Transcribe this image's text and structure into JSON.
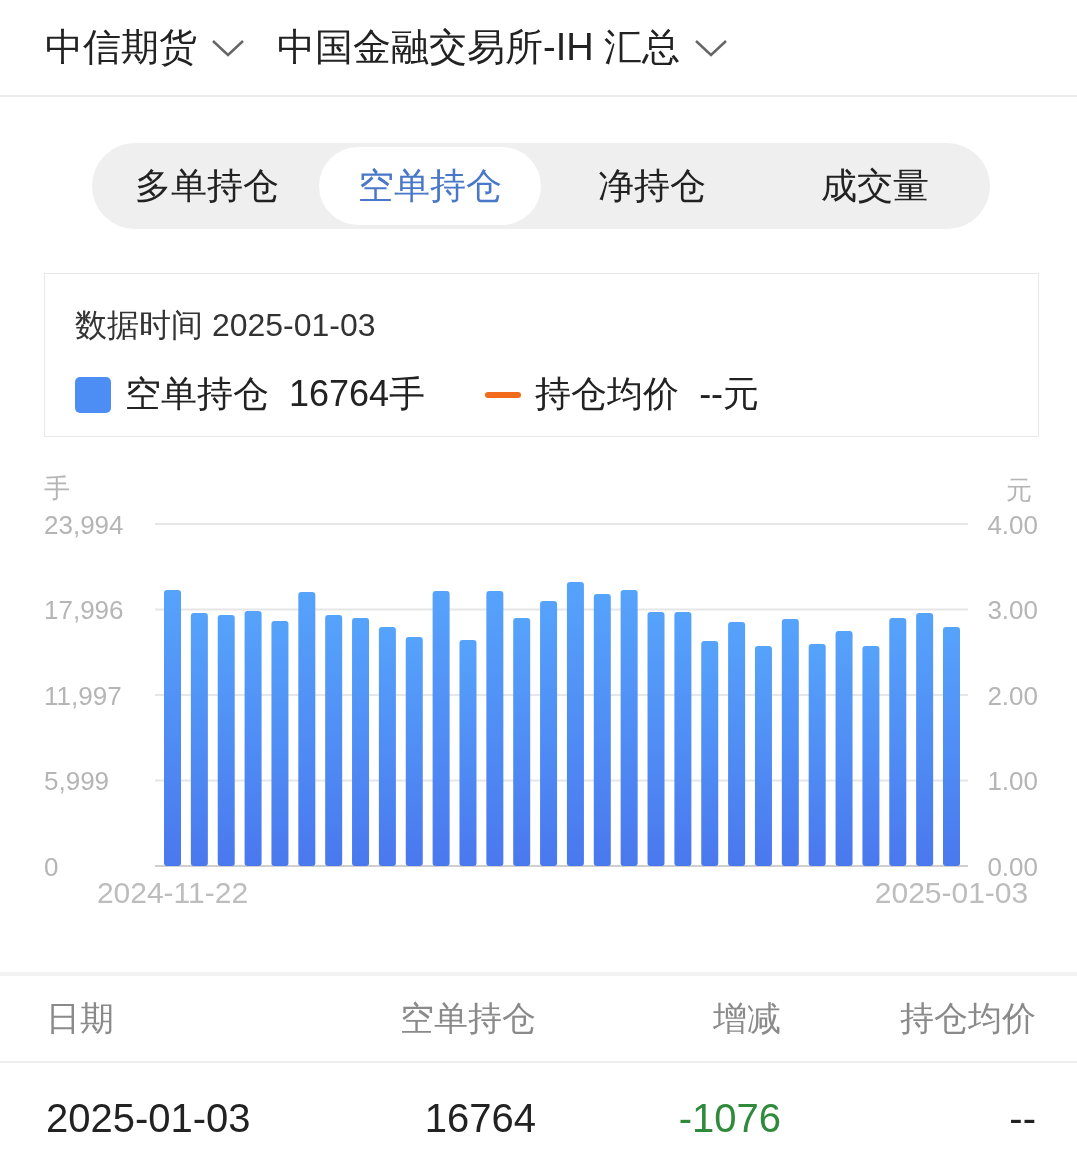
{
  "header": {
    "selectors": [
      {
        "label": "中信期货"
      },
      {
        "label": "中国金融交易所-IH 汇总"
      }
    ]
  },
  "tabs": [
    {
      "label": "多单持仓",
      "selected": false
    },
    {
      "label": "空单持仓",
      "selected": true
    },
    {
      "label": "净持仓",
      "selected": false
    },
    {
      "label": "成交量",
      "selected": false
    }
  ],
  "info": {
    "date_label": "数据时间 2025-01-03",
    "legend": [
      {
        "kind": "bar",
        "label": "空单持仓",
        "value": "16764手",
        "color": "#4d8ef5"
      },
      {
        "kind": "line",
        "label": "持仓均价",
        "value": "--元",
        "color": "#f26a1b"
      }
    ]
  },
  "chart": {
    "chart_data": {
      "type": "bar",
      "ylabel": "手",
      "y2label": "元",
      "ylim": [
        0,
        23994
      ],
      "yticks": [
        {
          "value": 0,
          "label": "0"
        },
        {
          "value": 5999,
          "label": "5,999"
        },
        {
          "value": 11997,
          "label": "11,997"
        },
        {
          "value": 17996,
          "label": "17,996"
        },
        {
          "value": 23994,
          "label": "23,994"
        }
      ],
      "y2ticks": [
        "0.00",
        "1.00",
        "2.00",
        "3.00",
        "4.00"
      ],
      "grid": true,
      "categories": [
        "2024-11-22",
        null,
        null,
        null,
        null,
        null,
        null,
        null,
        null,
        null,
        null,
        null,
        null,
        null,
        null,
        null,
        null,
        null,
        null,
        null,
        null,
        null,
        null,
        null,
        null,
        null,
        null,
        null,
        null,
        "2025-01-03"
      ],
      "series": [
        {
          "color": "#4a78ee",
          "values": [
            19360,
            17750,
            17610,
            17890,
            17190,
            19220,
            17610,
            17400,
            16770,
            16070,
            19290,
            15860,
            19290,
            17400,
            18590,
            19920,
            19080,
            19360,
            17820,
            17820,
            15790,
            17120,
            15440,
            17330,
            15580,
            16490,
            15440,
            17400,
            17750,
            16760
          ]
        }
      ]
    }
  },
  "table": {
    "columns": [
      "日期",
      "空单持仓",
      "增减",
      "持仓均价"
    ],
    "rows": [
      {
        "cells": [
          "2025-01-03",
          "16764",
          "-1076",
          "--"
        ],
        "color": "#2f8a3c"
      }
    ]
  }
}
